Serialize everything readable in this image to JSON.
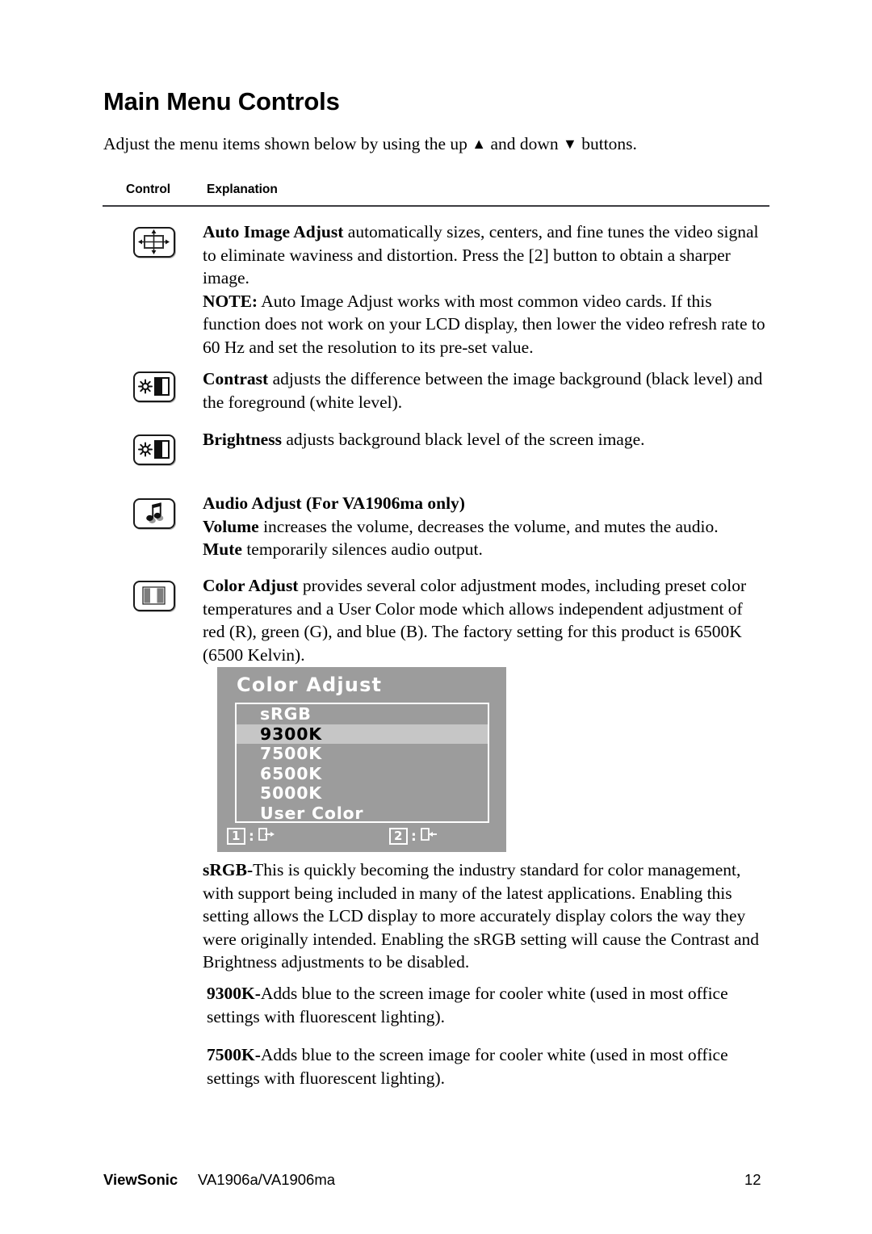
{
  "page": {
    "title": "Main Menu Controls",
    "intro_before": "Adjust the menu items shown below by using the up ",
    "intro_up_glyph": "▲",
    "intro_middle": " and down ",
    "intro_down_glyph": "▼",
    "intro_after": " buttons."
  },
  "table": {
    "header": {
      "control": "Control",
      "explanation": "Explanation"
    },
    "rows": [
      {
        "icon": "auto-image-adjust-icon",
        "term": "Auto Image Adjust",
        "body": " automatically sizes, centers, and fine tunes the video signal to eliminate waviness and distortion. Press the [2] button to obtain a sharper image.",
        "note_label": "NOTE:",
        "note_body": " Auto Image Adjust works with most common video cards. If this function does not work on your LCD display, then lower the video refresh rate to 60 Hz and set the resolution to its pre-set value."
      },
      {
        "icon": "contrast-icon",
        "term": "Contrast",
        "body": " adjusts the difference between the image background  (black level) and the foreground (white level)."
      },
      {
        "icon": "brightness-icon",
        "term": "Brightness",
        "body": " adjusts background black level of the screen image."
      },
      {
        "icon": "audio-adjust-icon",
        "heading": "Audio Adjust (For VA1906ma only)",
        "term": "Volume",
        "body": " increases the volume, decreases the volume, and mutes the audio.",
        "term2": "Mute",
        "body2": " temporarily silences audio output."
      },
      {
        "icon": "color-adjust-icon",
        "term": "Color Adjust",
        "body": " provides several color adjustment modes, including preset color temperatures and a User Color mode which allows independent adjustment of red (R), green (G), and blue (B). The factory setting for this product is 6500K (6500 Kelvin)."
      }
    ]
  },
  "osd": {
    "title": "Color Adjust",
    "items": [
      {
        "label": "sRGB",
        "selected": false
      },
      {
        "label": "9300K",
        "selected": true
      },
      {
        "label": "7500K",
        "selected": false
      },
      {
        "label": "6500K",
        "selected": false
      },
      {
        "label": "5000K",
        "selected": false
      },
      {
        "label": "User Color",
        "selected": false
      }
    ],
    "footer": {
      "key1": "1",
      "key1_sep": ":",
      "key1_icon": "exit-right-icon",
      "key2": "2",
      "key2_sep": ":",
      "key2_icon": "enter-left-icon"
    },
    "colors": {
      "background": "#9c9c9c",
      "selected_row": "#c6c6c6",
      "text": "#ffffff",
      "selected_text": "#000000"
    }
  },
  "paragraphs": [
    {
      "term": "sRGB-",
      "body": "This is quickly becoming the industry standard for color management, with support being included in many of the latest applications. Enabling this setting allows the LCD display to more accurately display colors the way they were originally intended. Enabling the sRGB setting will cause the Contrast and Brightness adjustments to be disabled."
    },
    {
      "term": "9300K-",
      "body": "Adds blue to the screen image for cooler white (used in most office settings with fluorescent lighting)."
    },
    {
      "term": "7500K-",
      "body": "Adds blue to the screen image for cooler white (used in most office settings with fluorescent lighting)."
    }
  ],
  "footer": {
    "brand": "ViewSonic",
    "model": "VA1906a/VA1906ma",
    "page_number": "12"
  }
}
